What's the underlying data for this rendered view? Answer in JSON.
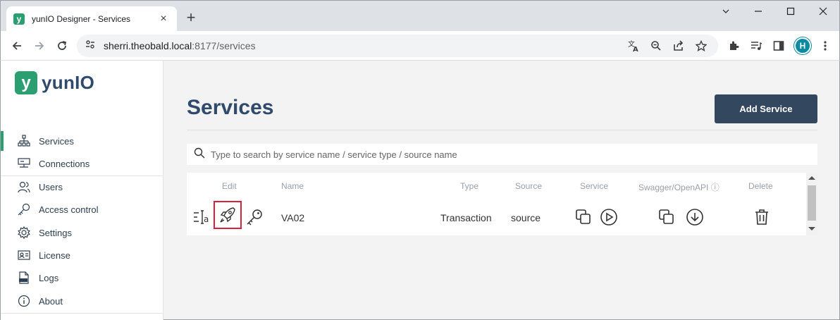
{
  "browser": {
    "tab_title": "yunIO Designer - Services",
    "tab_favicon_letter": "y",
    "new_tab": "+",
    "url_host": "sherri.theobald.local",
    "url_rest": ":8177/services",
    "profile_initial": "H",
    "window_controls": [
      "minimize",
      "maximize",
      "close"
    ]
  },
  "sidebar": {
    "logo_mark": "y",
    "logo_text": "yunIO",
    "items": [
      {
        "label": "Services",
        "icon": "sitemap-icon",
        "active": true
      },
      {
        "label": "Connections",
        "icon": "connections-icon",
        "active": false
      },
      {
        "label": "Users",
        "icon": "users-icon",
        "active": false
      },
      {
        "label": "Access control",
        "icon": "key-icon",
        "active": false
      },
      {
        "label": "Settings",
        "icon": "gear-icon",
        "active": false
      },
      {
        "label": "License",
        "icon": "license-icon",
        "active": false
      },
      {
        "label": "Logs",
        "icon": "logs-icon",
        "active": false
      },
      {
        "label": "About",
        "icon": "info-icon",
        "active": false
      }
    ]
  },
  "main": {
    "title": "Services",
    "add_button": "Add Service",
    "search_placeholder": "Type to search by service name / service type / source name",
    "table": {
      "headers": {
        "edit": "Edit",
        "name": "Name",
        "type": "Type",
        "source": "Source",
        "service": "Service",
        "swagger": "Swagger/OpenAPI ⓘ",
        "delete": "Delete"
      },
      "rows": [
        {
          "name": "VA02",
          "type": "Transaction",
          "source": "source"
        }
      ]
    }
  },
  "colors": {
    "brand": "#2b9f72",
    "title": "#2f4a6a",
    "button": "#33475f",
    "highlight": "#d6223c"
  }
}
